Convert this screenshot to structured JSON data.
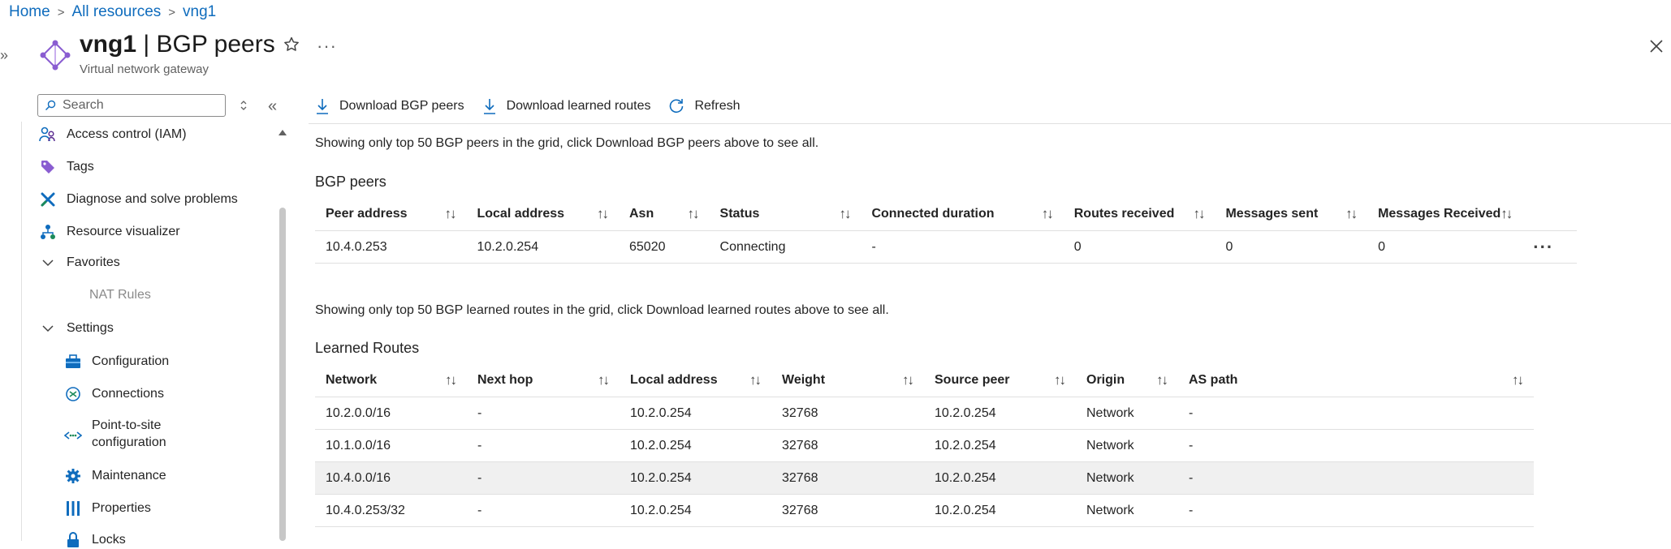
{
  "breadcrumb": {
    "home": "Home",
    "all_resources": "All resources",
    "current": "vng1"
  },
  "header": {
    "resource_name": "vng1",
    "separator": "|",
    "page_name": "BGP peers",
    "subtitle": "Virtual network gateway",
    "more": "···",
    "collapse": "»"
  },
  "sidebar": {
    "search_placeholder": "Search",
    "collapse": "«",
    "items": [
      {
        "label": "Access control (IAM)",
        "icon": "people-icon"
      },
      {
        "label": "Tags",
        "icon": "tag-icon"
      },
      {
        "label": "Diagnose and solve problems",
        "icon": "wrench-icon"
      },
      {
        "label": "Resource visualizer",
        "icon": "hierarchy-icon"
      },
      {
        "label": "Favorites",
        "icon": "chevron-down-icon"
      },
      {
        "label": "NAT Rules",
        "icon": ""
      },
      {
        "label": "Settings",
        "icon": "chevron-down-icon"
      },
      {
        "label": "Configuration",
        "icon": "toolbox-icon"
      },
      {
        "label": "Connections",
        "icon": "connections-icon"
      },
      {
        "label": "Point-to-site",
        "label2": "configuration",
        "icon": "vpn-icon"
      },
      {
        "label": "Maintenance",
        "icon": "gear-icon"
      },
      {
        "label": "Properties",
        "icon": "properties-icon"
      },
      {
        "label": "Locks",
        "icon": "lock-icon"
      }
    ]
  },
  "toolbar": {
    "download_peers": "Download BGP peers",
    "download_routes": "Download learned routes",
    "refresh": "Refresh"
  },
  "peers": {
    "info": "Showing only top 50 BGP peers in the grid, click Download BGP peers above to see all.",
    "title": "BGP peers",
    "columns": [
      "Peer address",
      "Local address",
      "Asn",
      "Status",
      "Connected duration",
      "Routes received",
      "Messages sent",
      "Messages Received"
    ],
    "sort_glyph": "↑↓",
    "rows": [
      [
        "10.4.0.253",
        "10.2.0.254",
        "65020",
        "Connecting",
        "-",
        "0",
        "0",
        "0"
      ]
    ],
    "row_more": "···"
  },
  "routes": {
    "info": "Showing only top 50 BGP learned routes in the grid, click Download learned routes above to see all.",
    "title": "Learned Routes",
    "columns": [
      "Network",
      "Next hop",
      "Local address",
      "Weight",
      "Source peer",
      "Origin",
      "AS path"
    ],
    "rows": [
      [
        "10.2.0.0/16",
        "-",
        "10.2.0.254",
        "32768",
        "10.2.0.254",
        "Network",
        "-"
      ],
      [
        "10.1.0.0/16",
        "-",
        "10.2.0.254",
        "32768",
        "10.2.0.254",
        "Network",
        "-"
      ],
      [
        "10.4.0.0/16",
        "-",
        "10.2.0.254",
        "32768",
        "10.2.0.254",
        "Network",
        "-"
      ],
      [
        "10.4.0.253/32",
        "-",
        "10.2.0.254",
        "32768",
        "10.2.0.254",
        "Network",
        "-"
      ]
    ],
    "selected_row": 2
  },
  "colors": {
    "accent": "#0f6cbd",
    "border": "#e0e0e0",
    "selected_row": "#f0f0f0"
  }
}
